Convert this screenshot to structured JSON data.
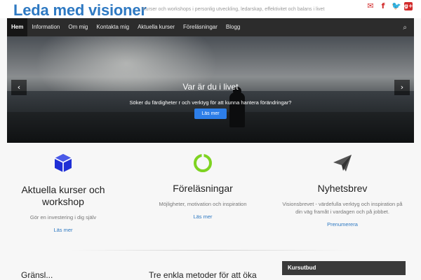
{
  "header": {
    "logo": "Leda med visioner",
    "tagline": "Kurser och workshops i personlig utveckling, ledarskap, effektivitet och balans i livet",
    "social": [
      "mail-icon",
      "facebook-icon",
      "twitter-icon",
      "google-plus-icon"
    ]
  },
  "nav": {
    "items": [
      "Hem",
      "Information",
      "Om mig",
      "Kontakta mig",
      "Aktuella kurser",
      "Föreläsningar",
      "Blogg"
    ],
    "active": "Hem"
  },
  "hero": {
    "title": "Var är du i livet",
    "subtitle": "Söker du färdigheter r och verktyg för att kunna hantera förändringar?",
    "button": "Läs mer"
  },
  "features": [
    {
      "icon": "cube-icon",
      "title": "Aktuella kurser och workshop",
      "text": "Gör en investering i dig själv",
      "link": "Läs mer"
    },
    {
      "icon": "ring-icon",
      "title": "Föreläsningar",
      "text": "Möjligheter, motivation och inspiration",
      "link": "Läs mer"
    },
    {
      "icon": "paper-plane-icon",
      "title": "Nyhetsbrev",
      "text": "Visionsbrevet - värdefulla verktyg och inspiration på din väg framåt i vardagen och på jobbet.",
      "link": "Prenumerera"
    }
  ],
  "bottom": {
    "left_title": "Gränsl...",
    "middle_title": "Tre enkla metoder för att öka",
    "widget_title": "Kursutbud"
  },
  "colors": {
    "brand": "#2e79c2",
    "nav": "#2c2c2c",
    "button": "#2d7ee8",
    "social": "#d22c2c",
    "ring": "#7ed321",
    "cube": "#1f2fd6"
  }
}
